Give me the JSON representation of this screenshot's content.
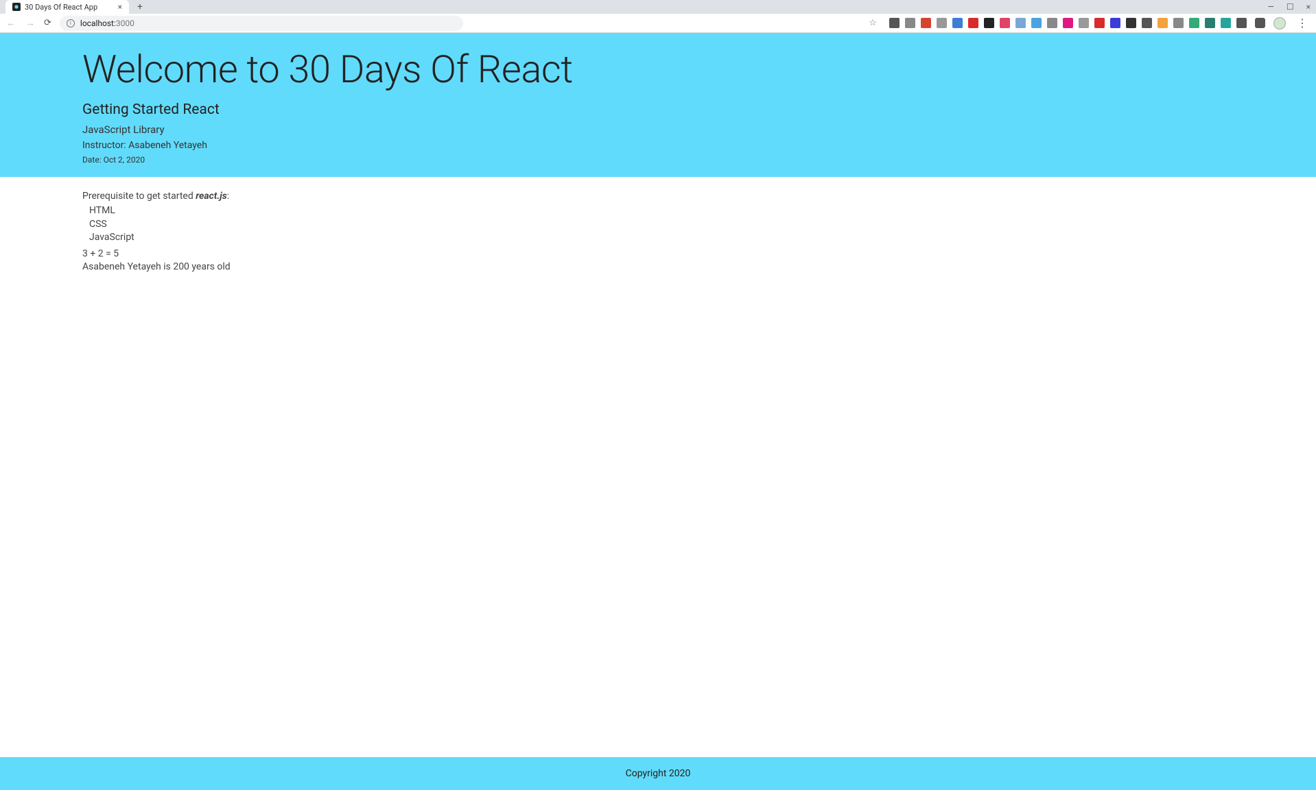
{
  "browser": {
    "tab_title": "30 Days Of React App",
    "url_host": "localhost:",
    "url_port": "3000"
  },
  "extensions": [
    {
      "name": "ext-1",
      "color": "#555"
    },
    {
      "name": "ext-2",
      "color": "#888"
    },
    {
      "name": "ext-3",
      "color": "#d6442f"
    },
    {
      "name": "ext-4",
      "color": "#999"
    },
    {
      "name": "ext-5",
      "color": "#3b7dd8"
    },
    {
      "name": "ext-6",
      "color": "#d92b2b"
    },
    {
      "name": "ext-7",
      "color": "#222"
    },
    {
      "name": "ext-8",
      "color": "#d46"
    },
    {
      "name": "ext-9",
      "color": "#7aa7d8"
    },
    {
      "name": "ext-10",
      "color": "#4aa3df"
    },
    {
      "name": "ext-11",
      "color": "#888"
    },
    {
      "name": "ext-12",
      "color": "#e01783"
    },
    {
      "name": "ext-13",
      "color": "#999"
    },
    {
      "name": "ext-14",
      "color": "#d92b2b"
    },
    {
      "name": "ext-15",
      "color": "#3b3bd8"
    },
    {
      "name": "ext-16",
      "color": "#333"
    },
    {
      "name": "ext-17",
      "color": "#555"
    },
    {
      "name": "ext-18",
      "color": "#f2a33c"
    },
    {
      "name": "ext-19",
      "color": "#888"
    },
    {
      "name": "ext-20",
      "color": "#3a7"
    },
    {
      "name": "ext-21",
      "color": "#2a7e6f"
    },
    {
      "name": "ext-22",
      "color": "#26a69a"
    },
    {
      "name": "ext-23",
      "color": "#555"
    }
  ],
  "header": {
    "title": "Welcome to 30 Days Of React",
    "subtitle": "Getting Started React",
    "library": "JavaScript Library",
    "instructor": "Instructor: Asabeneh Yetayeh",
    "date": "Date: Oct 2, 2020"
  },
  "main": {
    "prereq_prefix": "Prerequisite to get started ",
    "prereq_em": "react.js",
    "prereq_suffix": ":",
    "items": [
      "HTML",
      "CSS",
      "JavaScript"
    ],
    "math": "3 + 2 = 5",
    "age": "Asabeneh Yetayeh is 200 years old"
  },
  "footer": {
    "copyright": "Copyright 2020"
  }
}
